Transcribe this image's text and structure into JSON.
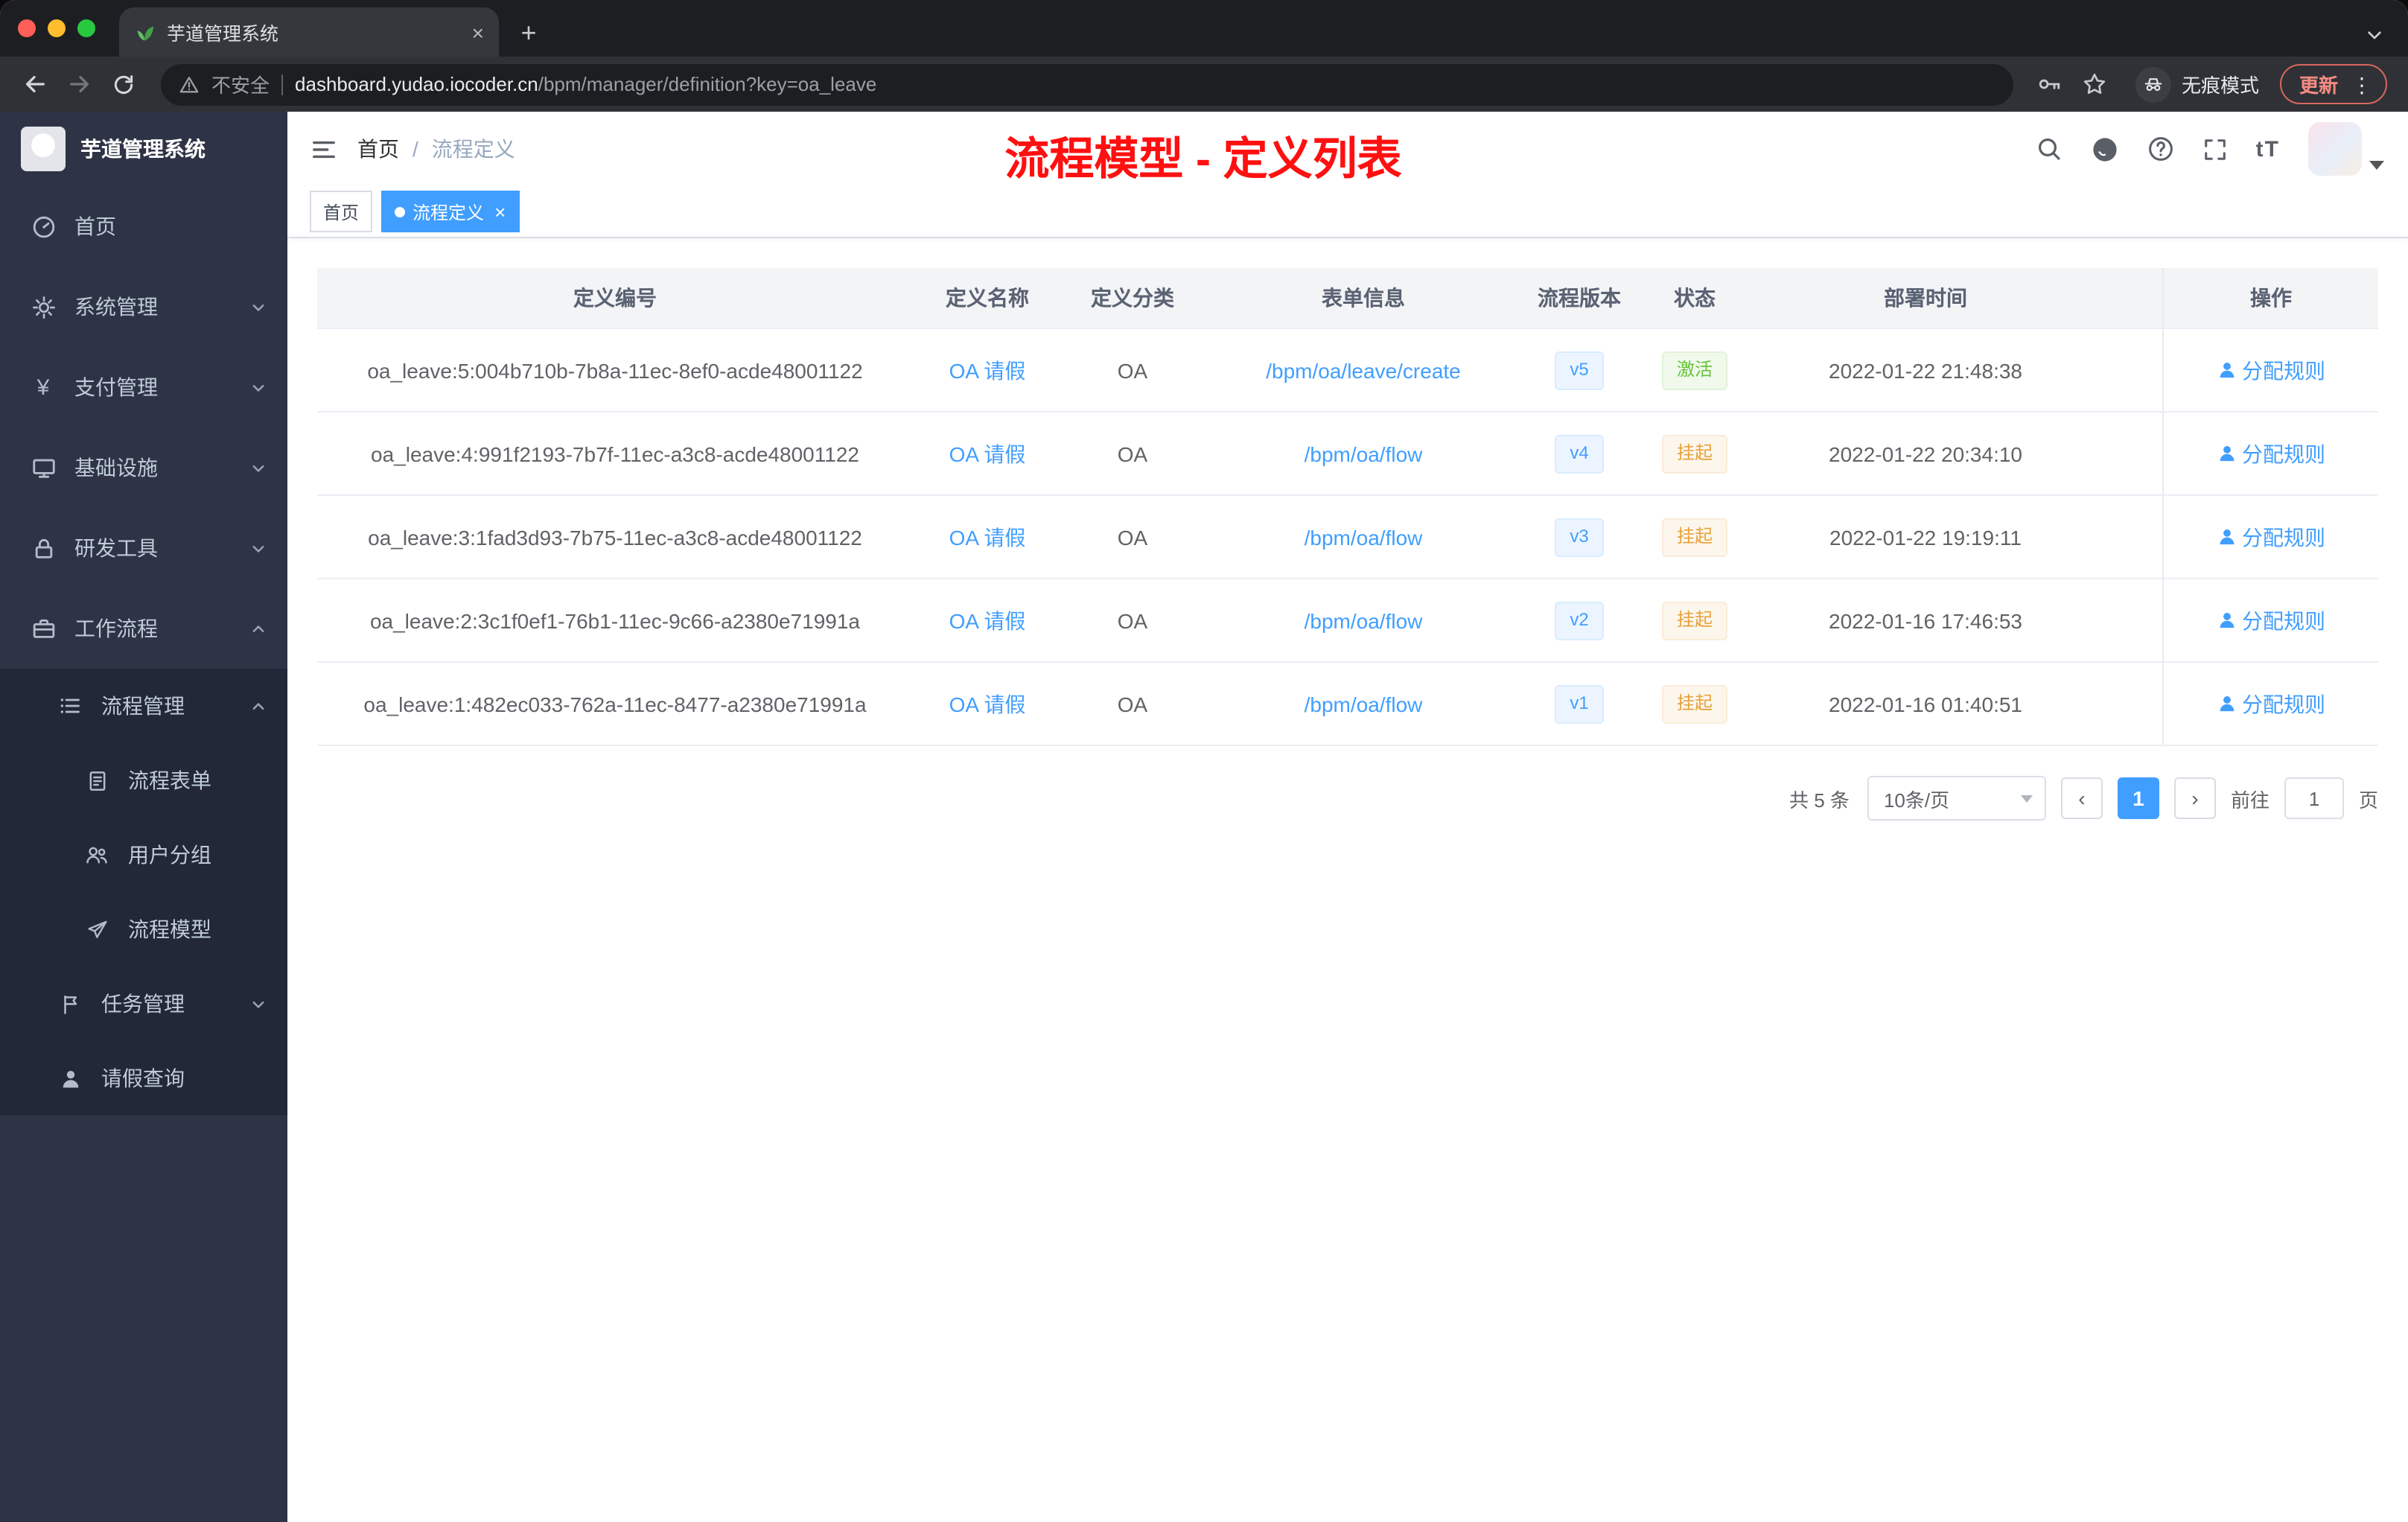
{
  "theme": {
    "accent": "#409eff",
    "success": "#67c23a",
    "warning": "#e6a23c",
    "annotation_red": "#ff1010",
    "sidebar_bg": "#2e3446",
    "submenu_bg": "#232839"
  },
  "icons": {
    "plus": "+",
    "tab_close": "×",
    "tag_close": "×",
    "more_vertical": "⋮",
    "yen_symbol": "¥",
    "page_prev": "‹",
    "page_next": "›",
    "font_size": "tT",
    "breadcrumb_separator": "/"
  },
  "browser": {
    "tab_title": "芋道管理系统",
    "security_label": "不安全",
    "url_host": "dashboard.yudao.iocoder.cn",
    "url_path": "/bpm/manager/definition?key=oa_leave",
    "incognito_label": "无痕模式",
    "update_label": "更新"
  },
  "sidebar": {
    "logo_title": "芋道管理系统",
    "items": {
      "home": "首页",
      "system": "系统管理",
      "payment": "支付管理",
      "infra": "基础设施",
      "devtools": "研发工具",
      "workflow": "工作流程",
      "process_mgmt": "流程管理",
      "process_form": "流程表单",
      "user_group": "用户分组",
      "process_model": "流程模型",
      "task_mgmt": "任务管理",
      "leave_query": "请假查询"
    }
  },
  "navbar": {
    "breadcrumb_home": "首页",
    "breadcrumb_current": "流程定义",
    "annotation": "流程模型 - 定义列表"
  },
  "tags": {
    "home": "首页",
    "current": "流程定义"
  },
  "table": {
    "columns": [
      "定义编号",
      "定义名称",
      "定义分类",
      "表单信息",
      "流程版本",
      "状态",
      "部署时间",
      "操作"
    ],
    "rows": [
      {
        "id": "oa_leave:5:004b710b-7b8a-11ec-8ef0-acde48001122",
        "name": "OA 请假",
        "category": "OA",
        "form": "/bpm/oa/leave/create",
        "version": "v5",
        "status": "激活",
        "time": "2022-01-22 21:48:38",
        "action": "分配规则"
      },
      {
        "id": "oa_leave:4:991f2193-7b7f-11ec-a3c8-acde48001122",
        "name": "OA 请假",
        "category": "OA",
        "form": "/bpm/oa/flow",
        "version": "v4",
        "status": "挂起",
        "time": "2022-01-22 20:34:10",
        "action": "分配规则"
      },
      {
        "id": "oa_leave:3:1fad3d93-7b75-11ec-a3c8-acde48001122",
        "name": "OA 请假",
        "category": "OA",
        "form": "/bpm/oa/flow",
        "version": "v3",
        "status": "挂起",
        "time": "2022-01-22 19:19:11",
        "action": "分配规则"
      },
      {
        "id": "oa_leave:2:3c1f0ef1-76b1-11ec-9c66-a2380e71991a",
        "name": "OA 请假",
        "category": "OA",
        "form": "/bpm/oa/flow",
        "version": "v2",
        "status": "挂起",
        "time": "2022-01-16 17:46:53",
        "action": "分配规则"
      },
      {
        "id": "oa_leave:1:482ec033-762a-11ec-8477-a2380e71991a",
        "name": "OA 请假",
        "category": "OA",
        "form": "/bpm/oa/flow",
        "version": "v1",
        "status": "挂起",
        "time": "2022-01-16 01:40:51",
        "action": "分配规则"
      }
    ]
  },
  "pagination": {
    "total": "共 5 条",
    "page_size": "10条/页",
    "current_page": "1",
    "goto_label": "前往",
    "goto_value": "1",
    "goto_unit": "页"
  }
}
